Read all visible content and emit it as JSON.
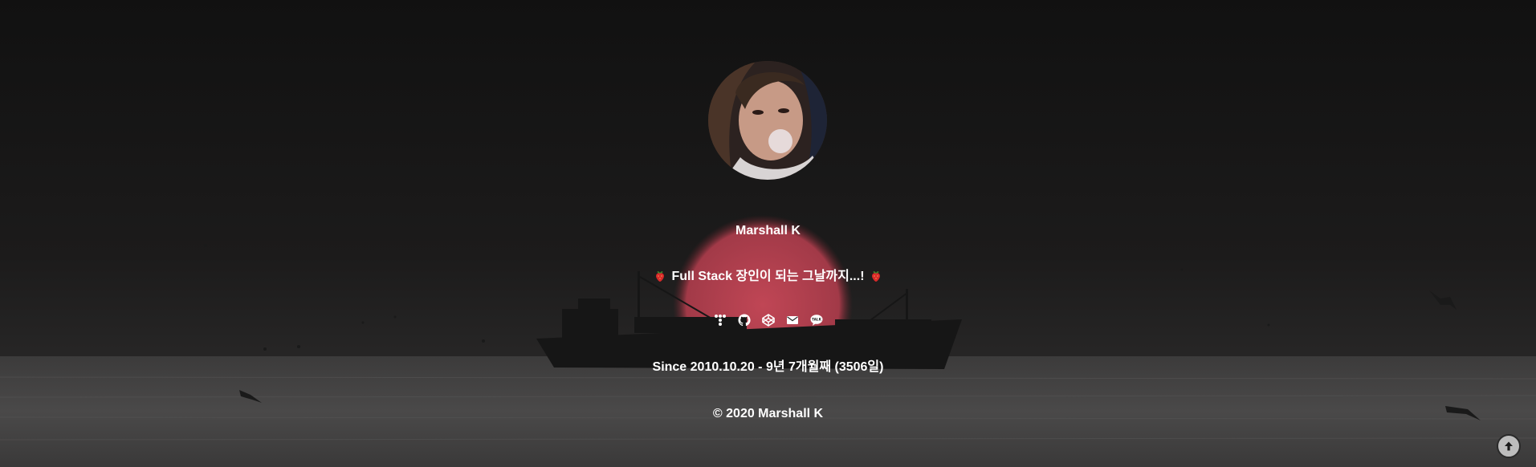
{
  "profile": {
    "name": "Marshall K",
    "tagline": "Full Stack 장인이 되는 그날까지...!",
    "since": "Since 2010.10.20 - 9년 7개월째 (3506일)",
    "copyright": "© 2020 Marshall K"
  },
  "socials": [
    {
      "icon": "tistory-icon"
    },
    {
      "icon": "github-icon"
    },
    {
      "icon": "codepen-icon"
    },
    {
      "icon": "mail-icon"
    },
    {
      "icon": "kakaotalk-icon",
      "badge": "TALK"
    }
  ],
  "colors": {
    "text": "#ffffff",
    "sun": "#b8424f",
    "background_top": "#141414"
  }
}
